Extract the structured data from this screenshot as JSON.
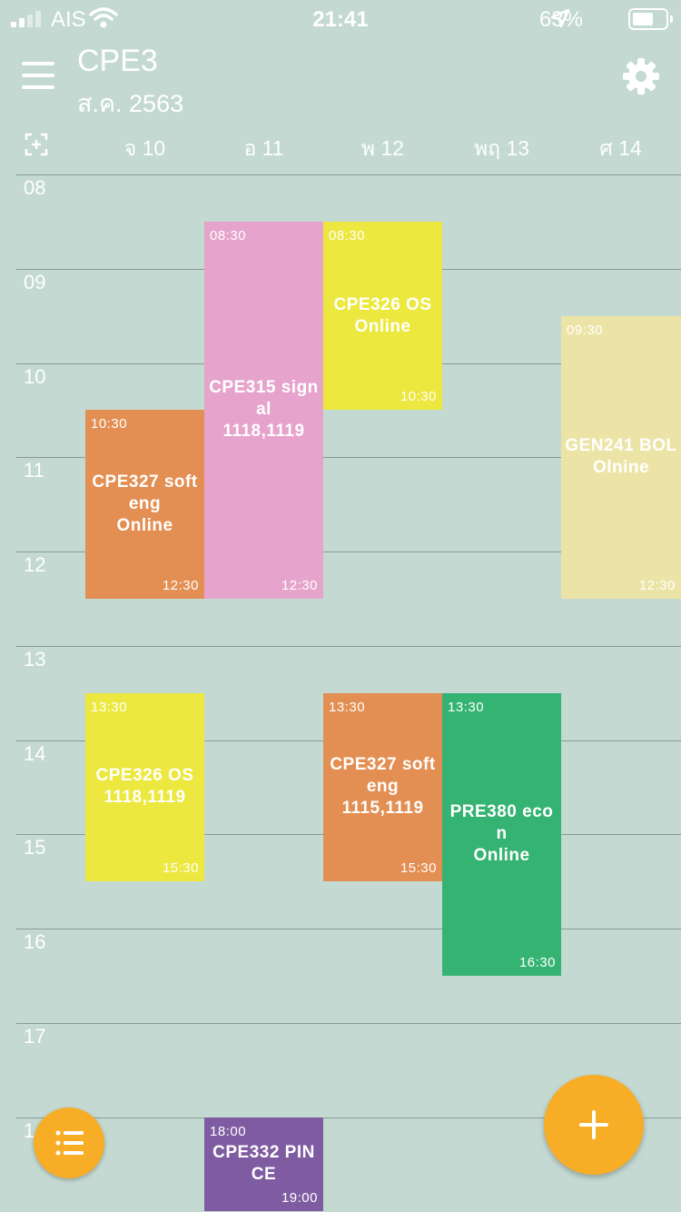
{
  "status_bar": {
    "carrier": "AIS",
    "time": "21:41",
    "battery": "63%"
  },
  "header": {
    "title": "CPE3",
    "subtitle": "ส.ค. 2563"
  },
  "days": [
    "จ 10",
    "อ 11",
    "พ 12",
    "พฤ 13",
    "ศ 14"
  ],
  "hours": [
    "08",
    "09",
    "10",
    "11",
    "12",
    "13",
    "14",
    "15",
    "16",
    "17",
    "1"
  ],
  "events": [
    {
      "start": "08:30",
      "end": "12:30",
      "name": "CPE315 sign\nal\n1118,1119",
      "color": "#e6a4cc"
    },
    {
      "start": "08:30",
      "end": "10:30",
      "name": "CPE326 OS\nOnline",
      "color": "#ece83f"
    },
    {
      "start": "09:30",
      "end": "12:30",
      "name": "GEN241 BOL\nOlnine",
      "color": "#ece4a6"
    },
    {
      "start": "10:30",
      "end": "12:30",
      "name": "CPE327 soft\neng\nOnline",
      "color": "#e38f53"
    },
    {
      "start": "13:30",
      "end": "15:30",
      "name": "CPE326 OS\n1118,1119",
      "color": "#ece83f"
    },
    {
      "start": "13:30",
      "end": "15:30",
      "name": "CPE327 soft\neng\n1115,1119",
      "color": "#e38f53"
    },
    {
      "start": "13:30",
      "end": "16:30",
      "name": "PRE380 eco\nn\nOnline",
      "color": "#35b373"
    },
    {
      "start": "18:00",
      "end": "19:00",
      "name": "CPE332 PIN\nCE",
      "color": "#7f5ca1"
    }
  ],
  "icons": {
    "menu": "hamburger-icon",
    "settings": "gear-icon",
    "today": "add-square-icon",
    "list": "list-icon",
    "add": "plus-icon"
  },
  "colors": {
    "background": "#c3d9d1",
    "fab": "#f8ad27"
  }
}
